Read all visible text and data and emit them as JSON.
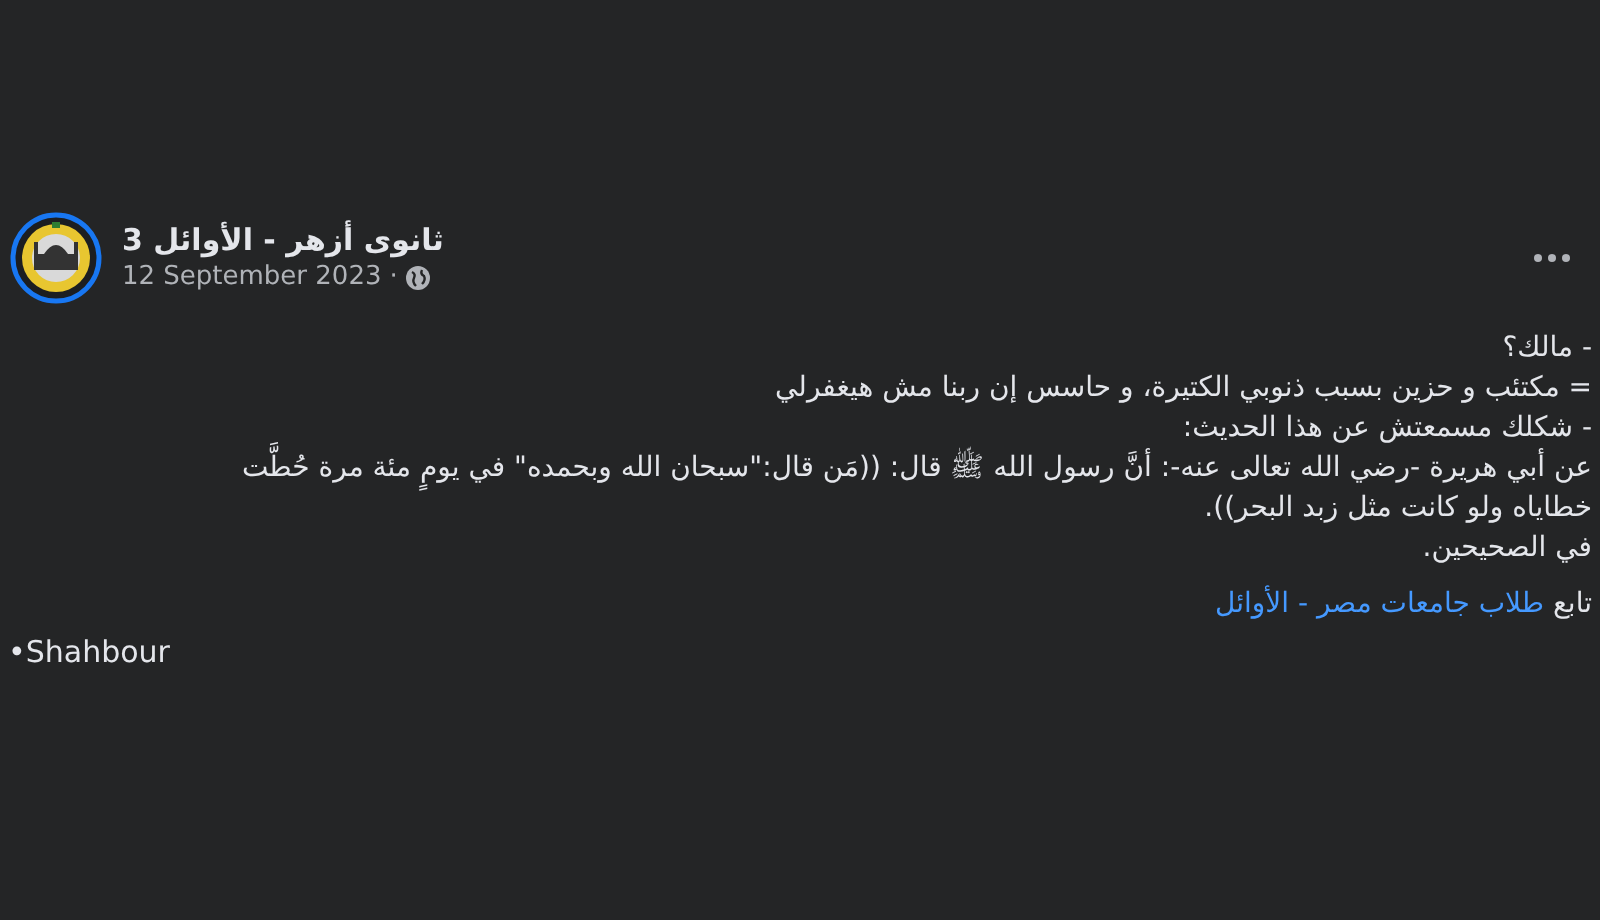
{
  "post": {
    "author": "ثانوى أزهر - الأوائل 3",
    "date": "12 September 2023",
    "separator": "·",
    "body_lines": [
      "- مالك؟",
      "= مكتئب و حزين بسبب ذنوبي الكتيرة، و حاسس إن ربنا مش هيغفرلي",
      "- شكلك مسمعتش عن هذا الحديث:",
      "عن أبي هريرة -رضي الله تعالى عنه-: أنَّ رسول الله ﷺ قال: ((مَن قال:\"سبحان الله وبحمده\" في يومٍ مئة مرة حُطَّت",
      "خطاياه ولو كانت مثل زبد البحر)).",
      "في الصحيحين."
    ],
    "follow": {
      "prefix": "تابع",
      "link": "طلاب جامعات مصر - الأوائل"
    },
    "signature": "•Shahbour"
  }
}
